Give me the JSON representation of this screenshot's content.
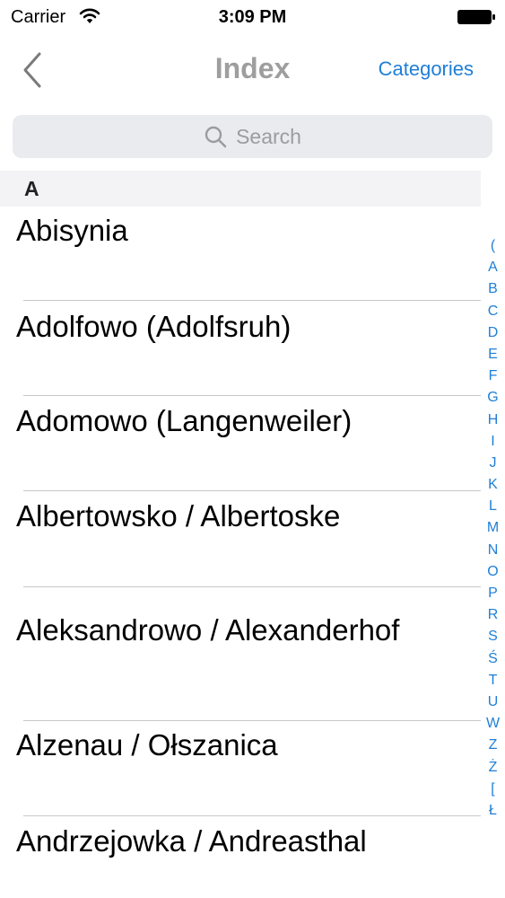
{
  "status_bar": {
    "carrier": "Carrier",
    "time": "3:09 PM"
  },
  "nav": {
    "title": "Index",
    "right_button": "Categories"
  },
  "search": {
    "placeholder": "Search"
  },
  "section": {
    "letter": "A"
  },
  "rows": [
    {
      "label": "Abisynia"
    },
    {
      "label": "Adolfowo (Adolfsruh)"
    },
    {
      "label": "Adomowo (Langenweiler)"
    },
    {
      "label": "Albertowsko / Albertoske"
    },
    {
      "label": "Aleksandrowo / Alexanderhof"
    },
    {
      "label": "Alzenau / Ołszanica"
    },
    {
      "label": "Andrzejowka / Andreasthal"
    }
  ],
  "index": [
    "(",
    "A",
    "B",
    "C",
    "D",
    "E",
    "F",
    "G",
    "H",
    "I",
    "J",
    "K",
    "L",
    "M",
    "N",
    "O",
    "P",
    "R",
    "S",
    "Ś",
    "T",
    "U",
    "W",
    "Z",
    "Ż",
    "[",
    "Ł"
  ],
  "colors": {
    "accent": "#1f7fd7",
    "title_gray": "#9e9e9e"
  }
}
